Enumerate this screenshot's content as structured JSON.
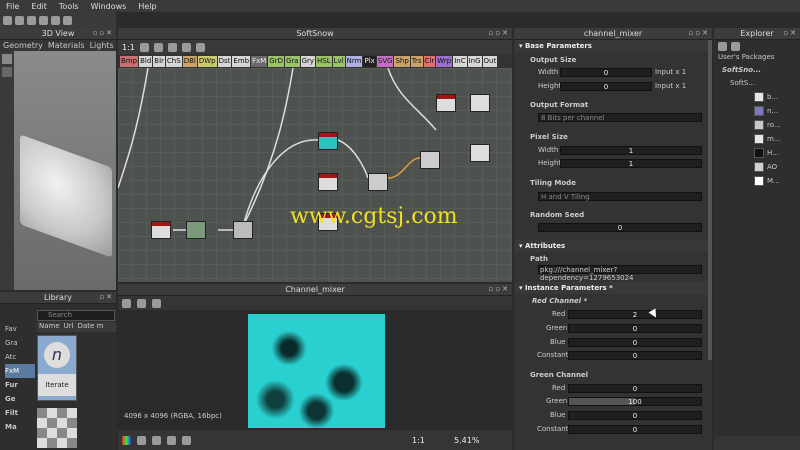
{
  "menu": [
    "File",
    "Edit",
    "Tools",
    "Windows",
    "Help"
  ],
  "view3d": {
    "title": "3D View",
    "tabs": [
      "Geometry",
      "Materials",
      "Lights"
    ]
  },
  "graph": {
    "title": "SoftSnow",
    "zoom": "1:1",
    "atoms": [
      "Bmp",
      "Bld",
      "Blr",
      "ChS",
      "DBl",
      "DWp",
      "Dst",
      "Emb",
      "FxM",
      "GrD",
      "Gra",
      "Gry",
      "HSL",
      "Lvl",
      "Nrm",
      "Plx",
      "SVG",
      "Shp",
      "Trs",
      "Clr",
      "Wrp",
      "InC",
      "InG",
      "Out"
    ],
    "atom_colors": [
      "#c97070",
      "#d6d6d6",
      "#d6d6d6",
      "#d6d6d6",
      "#c9a36a",
      "#c9c970",
      "#d6d6d6",
      "#d6d6d6",
      "#6a6a6a",
      "#9ac26a",
      "#9ac26a",
      "#d6d6d6",
      "#9ac26a",
      "#9ac26a",
      "#b0b0e0",
      "#222222",
      "#c070c0",
      "#c9a36a",
      "#c9a36a",
      "#e07070",
      "#9a70c9",
      "#d6d6d6",
      "#d6d6d6",
      "#d6d6d6"
    ]
  },
  "watermark": "www.cgtsj.com",
  "library": {
    "title": "Library",
    "search_placeholder": "Search",
    "tree": [
      "Fav",
      "Gra",
      "Atc",
      "FxM",
      "Fur",
      "Ge",
      "Filt",
      "Ma"
    ],
    "columns": [
      "Name",
      "Url",
      "Date m"
    ],
    "item_label": "Iterate"
  },
  "view2d": {
    "title": "Channel_mixer",
    "info": "4096 x 4096 (RGBA, 16bpc)",
    "ratio": "1:1",
    "zoom": "5.41%"
  },
  "properties": {
    "title": "channel_mixer",
    "base": "Base Parameters",
    "output_size": "Output Size",
    "width_label": "Width",
    "height_label": "Height",
    "output_size_width": "0",
    "output_size_height": "0",
    "output_size_width_unit": "Input x 1",
    "output_size_height_unit": "Input x 1",
    "output_format": "Output Format",
    "output_format_value": "8 Bits per channel",
    "pixel_size": "Pixel Size",
    "pixel_width": "1",
    "pixel_height": "1",
    "tiling_mode": "Tiling Mode",
    "tiling_value": "H and V Tiling",
    "random_seed": "Random Seed",
    "random_seed_value": "0",
    "attributes": "Attributes",
    "path_label": "Path",
    "path_value": "pkg:///channel_mixer?dependency=1279653024",
    "instance": "Instance Parameters *",
    "red_channel": "Red Channel *",
    "red": {
      "Red": "2",
      "Green": "0",
      "Blue": "0",
      "Constant": "0"
    },
    "green_channel": "Green Channel",
    "green": {
      "Red": "0",
      "Green": "100",
      "Blue": "0",
      "Constant": "0"
    },
    "green_fill": 0.5,
    "red_fill": 0.02,
    "labels": [
      "Red",
      "Green",
      "Blue",
      "Constant"
    ]
  },
  "explorer": {
    "title": "Explorer",
    "packages": "User's Packages",
    "package": "SoftSno...",
    "graph": "SoftS...",
    "items": [
      "b...",
      "n...",
      "ro...",
      "m...",
      "H...",
      "AO",
      "M..."
    ],
    "item_colors": [
      "#e6e6e6",
      "#7a7ab8",
      "#c8c8c8",
      "#e6e6e6",
      "#111111",
      "#d0d0d0",
      "#ffffff"
    ]
  }
}
